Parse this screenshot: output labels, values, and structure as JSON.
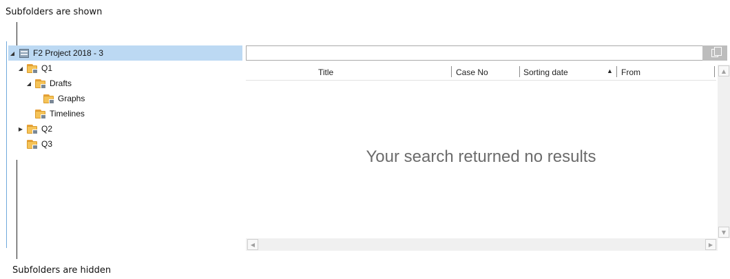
{
  "annotations": {
    "top": "Subfolders are shown",
    "bottom": "Subfolders are hidden"
  },
  "tree": {
    "nodes": [
      {
        "label": "F2 Project 2018 - 3",
        "icon": "project-icon",
        "expander": "expanded",
        "selected": true
      },
      {
        "label": "Q1",
        "icon": "folder-icon",
        "expander": "expanded",
        "selected": false
      },
      {
        "label": "Drafts",
        "icon": "folder-icon",
        "expander": "expanded",
        "selected": false
      },
      {
        "label": "Graphs",
        "icon": "folder-icon",
        "expander": "none",
        "selected": false
      },
      {
        "label": "Timelines",
        "icon": "folder-icon",
        "expander": "none",
        "selected": false
      },
      {
        "label": "Q2",
        "icon": "folder-icon",
        "expander": "collapsed",
        "selected": false
      },
      {
        "label": "Q3",
        "icon": "folder-icon",
        "expander": "none",
        "selected": false
      }
    ]
  },
  "search": {
    "value": "",
    "button_icon": "copy-icon"
  },
  "grid": {
    "columns": [
      "Title",
      "Case No",
      "Sorting date",
      "From"
    ],
    "sort_column": "Sorting date",
    "sort_direction": "ascending",
    "empty_message": "Your search returned no results"
  },
  "colors": {
    "selection": "#bcd9f3",
    "folder": "#f5c358",
    "empty_text": "#6b6b6b"
  }
}
